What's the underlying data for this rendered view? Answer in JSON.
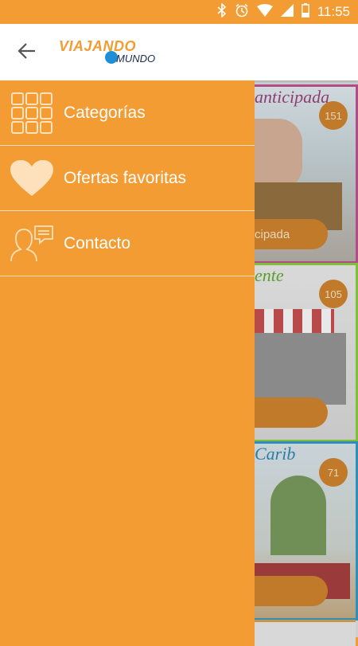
{
  "status": {
    "time": "11:55",
    "icons": [
      "bluetooth-icon",
      "alarm-icon",
      "wifi-icon",
      "signal-icon",
      "battery-icon"
    ]
  },
  "app_bar": {
    "back_icon": "arrow-back-icon",
    "logo_line1": "VIAJANDO",
    "logo_line2": "MUNDO"
  },
  "drawer": {
    "items": [
      {
        "label": "Categorías",
        "icon": "grid-icon"
      },
      {
        "label": "Ofertas favoritas",
        "icon": "heart-icon"
      },
      {
        "label": "Contacto",
        "icon": "contact-icon"
      }
    ]
  },
  "content": {
    "cards": [
      {
        "title": "anticipada",
        "count": "151",
        "pill": "cipada"
      },
      {
        "title": "ente",
        "count": "105",
        "pill": ""
      },
      {
        "title": "Carib",
        "count": "71",
        "pill": ""
      }
    ]
  },
  "colors": {
    "accent": "#f39c33",
    "drawer_divider": "#fde1bd"
  }
}
